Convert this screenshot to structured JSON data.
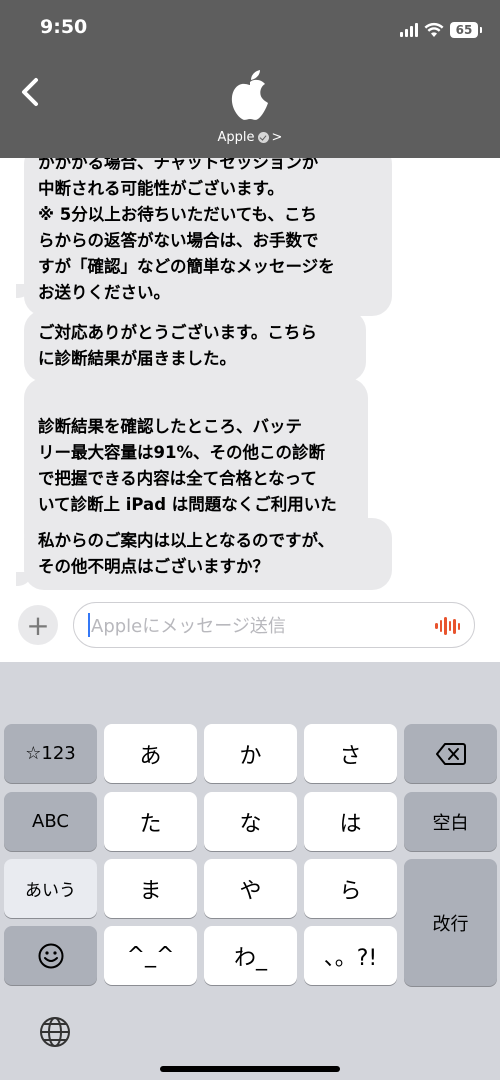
{
  "status": {
    "time": "9:50",
    "battery": "65"
  },
  "header": {
    "contact_name": "Apple",
    "chevron": ">"
  },
  "messages": [
    "かかかる場合、チャットセッションが\n中断される可能性がございます。\n※ 5分以上お待ちいただいても、こち\nらからの返答がない場合は、お手数で\nすが「確認」などの簡単なメッセージを\nお送りください。",
    "ご対応ありがとうございます。こちら\nに診断結果が届きました。",
    "診断結果を確認したところ、バッテ\nリー最大容量は91%、その他この診断\nで把握できる内容は全て合格となって\nいて診断上 iPad は問題なくご利用いた\nだけることが伺えます",
    "私からのご案内は以上となるのですが、\nその他不明点はございますか？"
  ],
  "input": {
    "plus": "+",
    "placeholder": "Appleにメッセージ送信"
  },
  "keyboard": {
    "row1": [
      "☆123",
      "あ",
      "か",
      "さ"
    ],
    "row2": [
      "ABC",
      "た",
      "な",
      "は",
      "空白"
    ],
    "row3": [
      "あいう",
      "ま",
      "や",
      "ら",
      "改行"
    ],
    "row4": [
      "^_^",
      "わ_",
      "、。?!"
    ]
  },
  "icons": [
    "back-chevron-icon",
    "apple-logo-icon",
    "verified-badge-icon",
    "audio-waveform-icon",
    "delete-key-icon",
    "emoji-icon",
    "globe-icon"
  ]
}
